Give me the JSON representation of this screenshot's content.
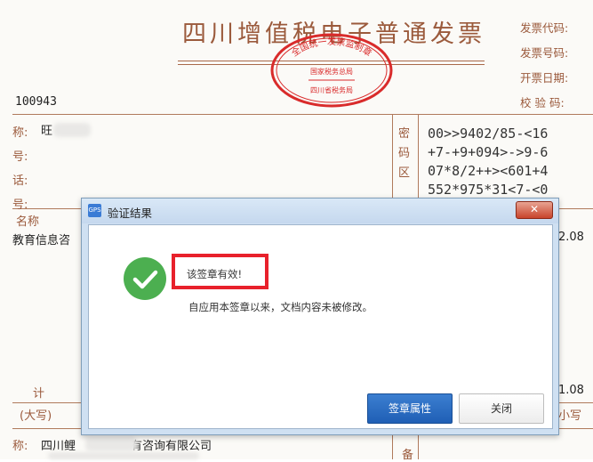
{
  "invoice": {
    "title": "四川增值税电子普通发票",
    "meta_labels": [
      "发票代码:",
      "发票号码:",
      "开票日期:",
      "校 验 码:"
    ],
    "number_fragment": "100943",
    "seal": {
      "top_text": "全国统一发票监制章",
      "middle_text": "国家税务总局",
      "bottom_text": "四川省税务局",
      "color": "#d92b2b"
    },
    "buyer_labels": [
      "称:",
      "号:",
      "话:",
      "号:"
    ],
    "buyer_name_fragment": "旺",
    "password_area_label": "密码区",
    "cipher_lines": [
      "00>>9402/85-<16",
      "+7-+9+094>->9-6",
      "07*8/2++><601+4",
      "552*975*31<7-<0"
    ],
    "item_header": "名称",
    "item_name_fragment": "教育信息咨",
    "right_value_1": "2.08",
    "total_label": "计",
    "right_value_2": "1.08",
    "uppercase_label": "(大写)",
    "lowercase_label": "小写",
    "seller_label": "称:",
    "seller_name_fragment": "四川鲤",
    "seller_name_suffix": "有咨询有限公司",
    "remarks_label": "备"
  },
  "dialog": {
    "app_icon": "GPS",
    "title": "验证结果",
    "close_glyph": "✕",
    "status_icon": "check-circle-icon",
    "primary_message": "该签章有效!",
    "secondary_message": "自应用本签章以来，文档内容未被修改。",
    "buttons": {
      "properties": "签章属性",
      "close": "关闭"
    }
  },
  "colors": {
    "accent": "#1f5fb5",
    "success": "#4caf50",
    "highlight": "#e8212b",
    "invoice_text": "#9b5a3c"
  }
}
